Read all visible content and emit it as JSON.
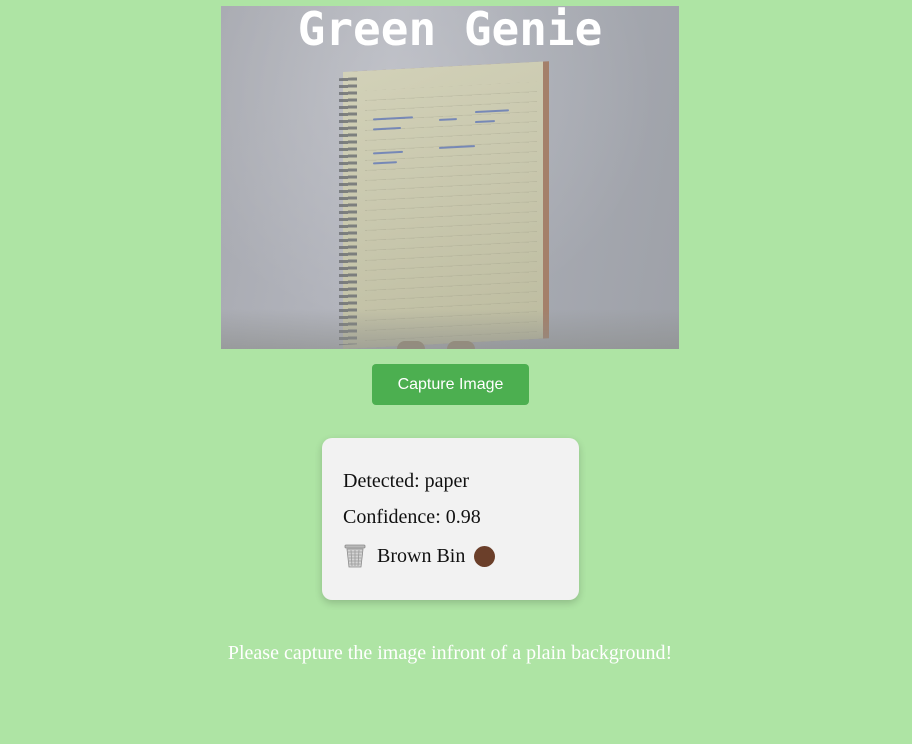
{
  "app": {
    "overlay_title": "Green Genie"
  },
  "controls": {
    "capture_label": "Capture Image"
  },
  "result": {
    "detected_label": "Detected:",
    "detected_value": "paper",
    "confidence_label": "Confidence:",
    "confidence_value": "0.98",
    "bin_icon": "wastebasket-icon",
    "bin_label": "Brown Bin",
    "bin_color": "#6b3f2a"
  },
  "tip": {
    "text": "Please capture the image infront of a plain background!"
  },
  "colors": {
    "page_background": "#aee4a4",
    "button_background": "#4caf50",
    "card_background": "#f2f2f2"
  }
}
